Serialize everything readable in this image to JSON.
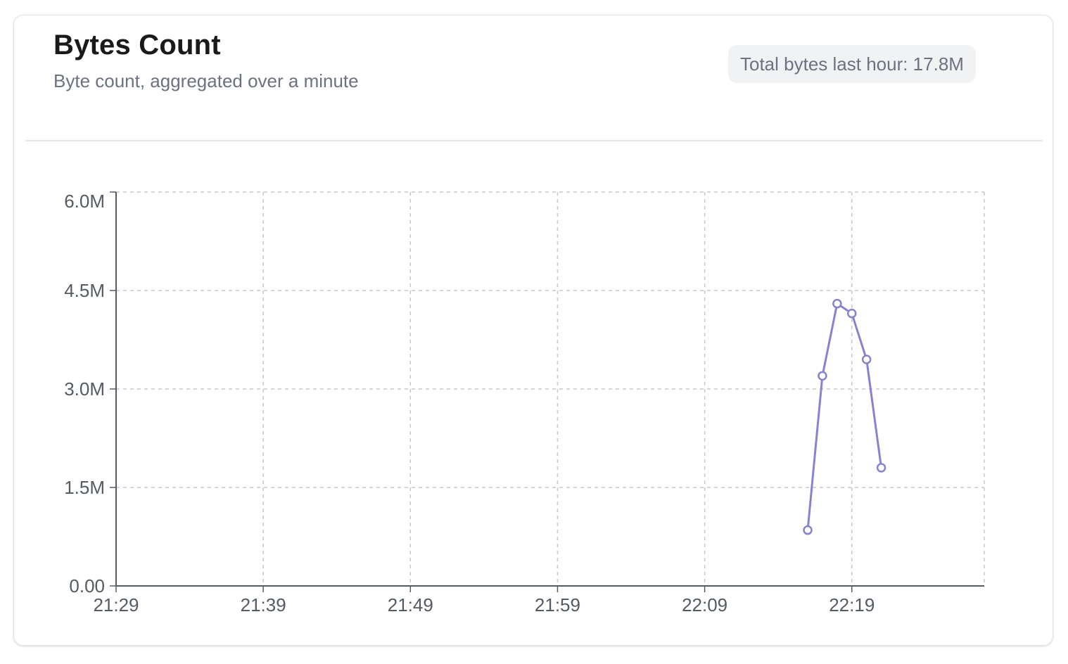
{
  "card": {
    "title": "Bytes Count",
    "subtitle": "Byte count, aggregated over a minute",
    "badge": "Total bytes last hour: 17.8M"
  },
  "colors": {
    "series": "#8783cf",
    "grid": "#c8c8c8",
    "axis": "#555b63"
  },
  "chart_data": {
    "type": "line",
    "title": "",
    "xlabel": "",
    "ylabel": "",
    "x_ticks": [
      "21:29",
      "21:39",
      "21:49",
      "21:59",
      "22:09",
      "22:19"
    ],
    "y_ticks": [
      "0.00",
      "1.5M",
      "3.0M",
      "4.5M",
      "6.0M"
    ],
    "xlim": [
      "21:29",
      "22:28"
    ],
    "ylim": [
      0,
      6000000
    ],
    "grid": true,
    "series": [
      {
        "x": [
          "22:16",
          "22:17",
          "22:18",
          "22:19",
          "22:20",
          "22:21"
        ],
        "values": [
          850000,
          3200000,
          4300000,
          4150000,
          3450000,
          1800000
        ],
        "color": "#8783cf",
        "markers": "hollow-circle"
      }
    ]
  }
}
